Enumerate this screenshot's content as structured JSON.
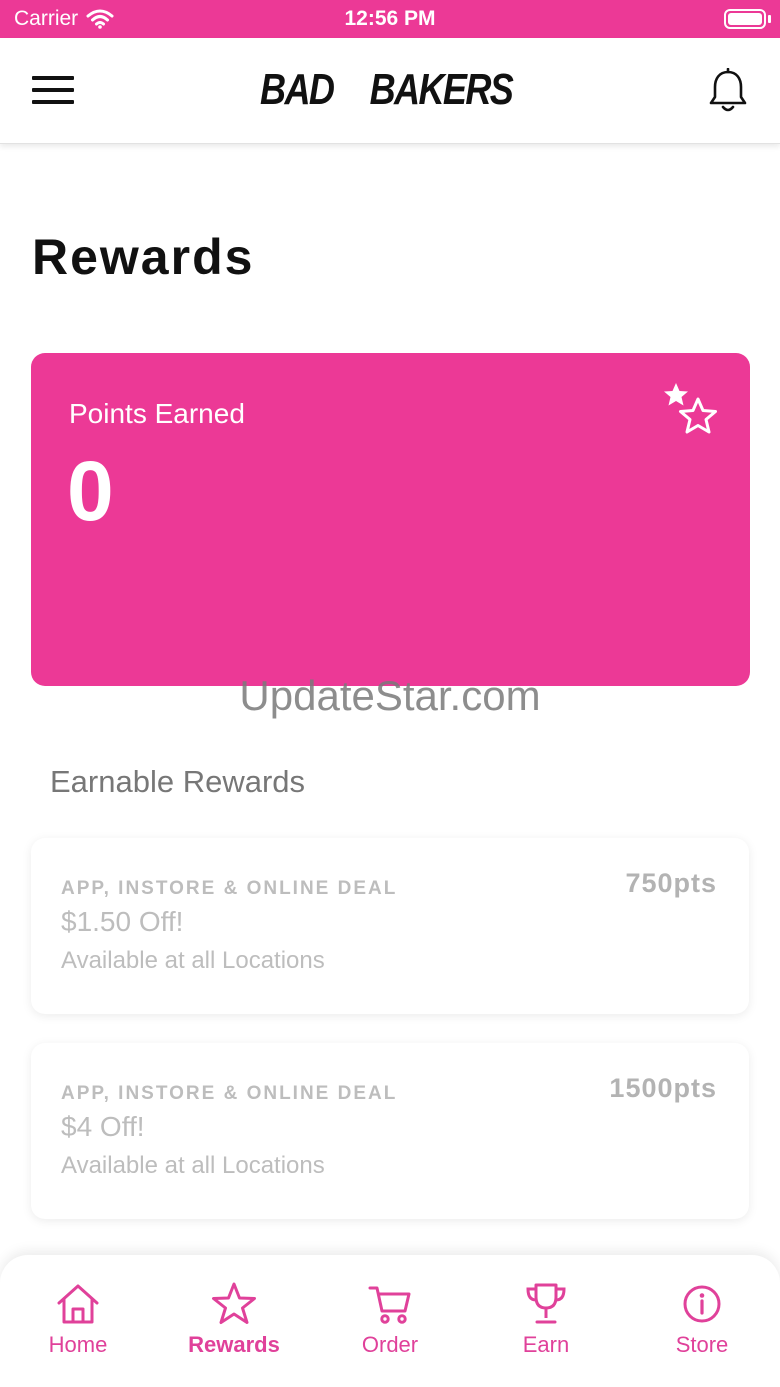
{
  "status_bar": {
    "carrier": "Carrier",
    "time": "12:56 PM"
  },
  "header": {
    "logo_left": "BAD",
    "logo_right": "BAKERS",
    "logo_icon": "donut-icon"
  },
  "page": {
    "title": "Rewards"
  },
  "points_card": {
    "label": "Points Earned",
    "value": "0",
    "icon": "stars-icon"
  },
  "watermark": "UpdateStar.com",
  "earnable": {
    "title": "Earnable Rewards",
    "items": [
      {
        "category": "APP, INSTORE & ONLINE DEAL",
        "name": "$1.50 Off!",
        "availability": "Available at all Locations",
        "points": "750pts"
      },
      {
        "category": "APP, INSTORE & ONLINE DEAL",
        "name": "$4 Off!",
        "availability": "Available at all Locations",
        "points": "1500pts"
      }
    ]
  },
  "tabs": [
    {
      "label": "Home",
      "icon": "home-icon"
    },
    {
      "label": "Rewards",
      "icon": "star-icon",
      "active": true
    },
    {
      "label": "Order",
      "icon": "cart-icon"
    },
    {
      "label": "Earn",
      "icon": "trophy-icon"
    },
    {
      "label": "Store",
      "icon": "info-icon"
    }
  ],
  "colors": {
    "accent": "#ec3996",
    "tab_accent": "#e0419a",
    "muted_text": "#bdbdbd"
  }
}
